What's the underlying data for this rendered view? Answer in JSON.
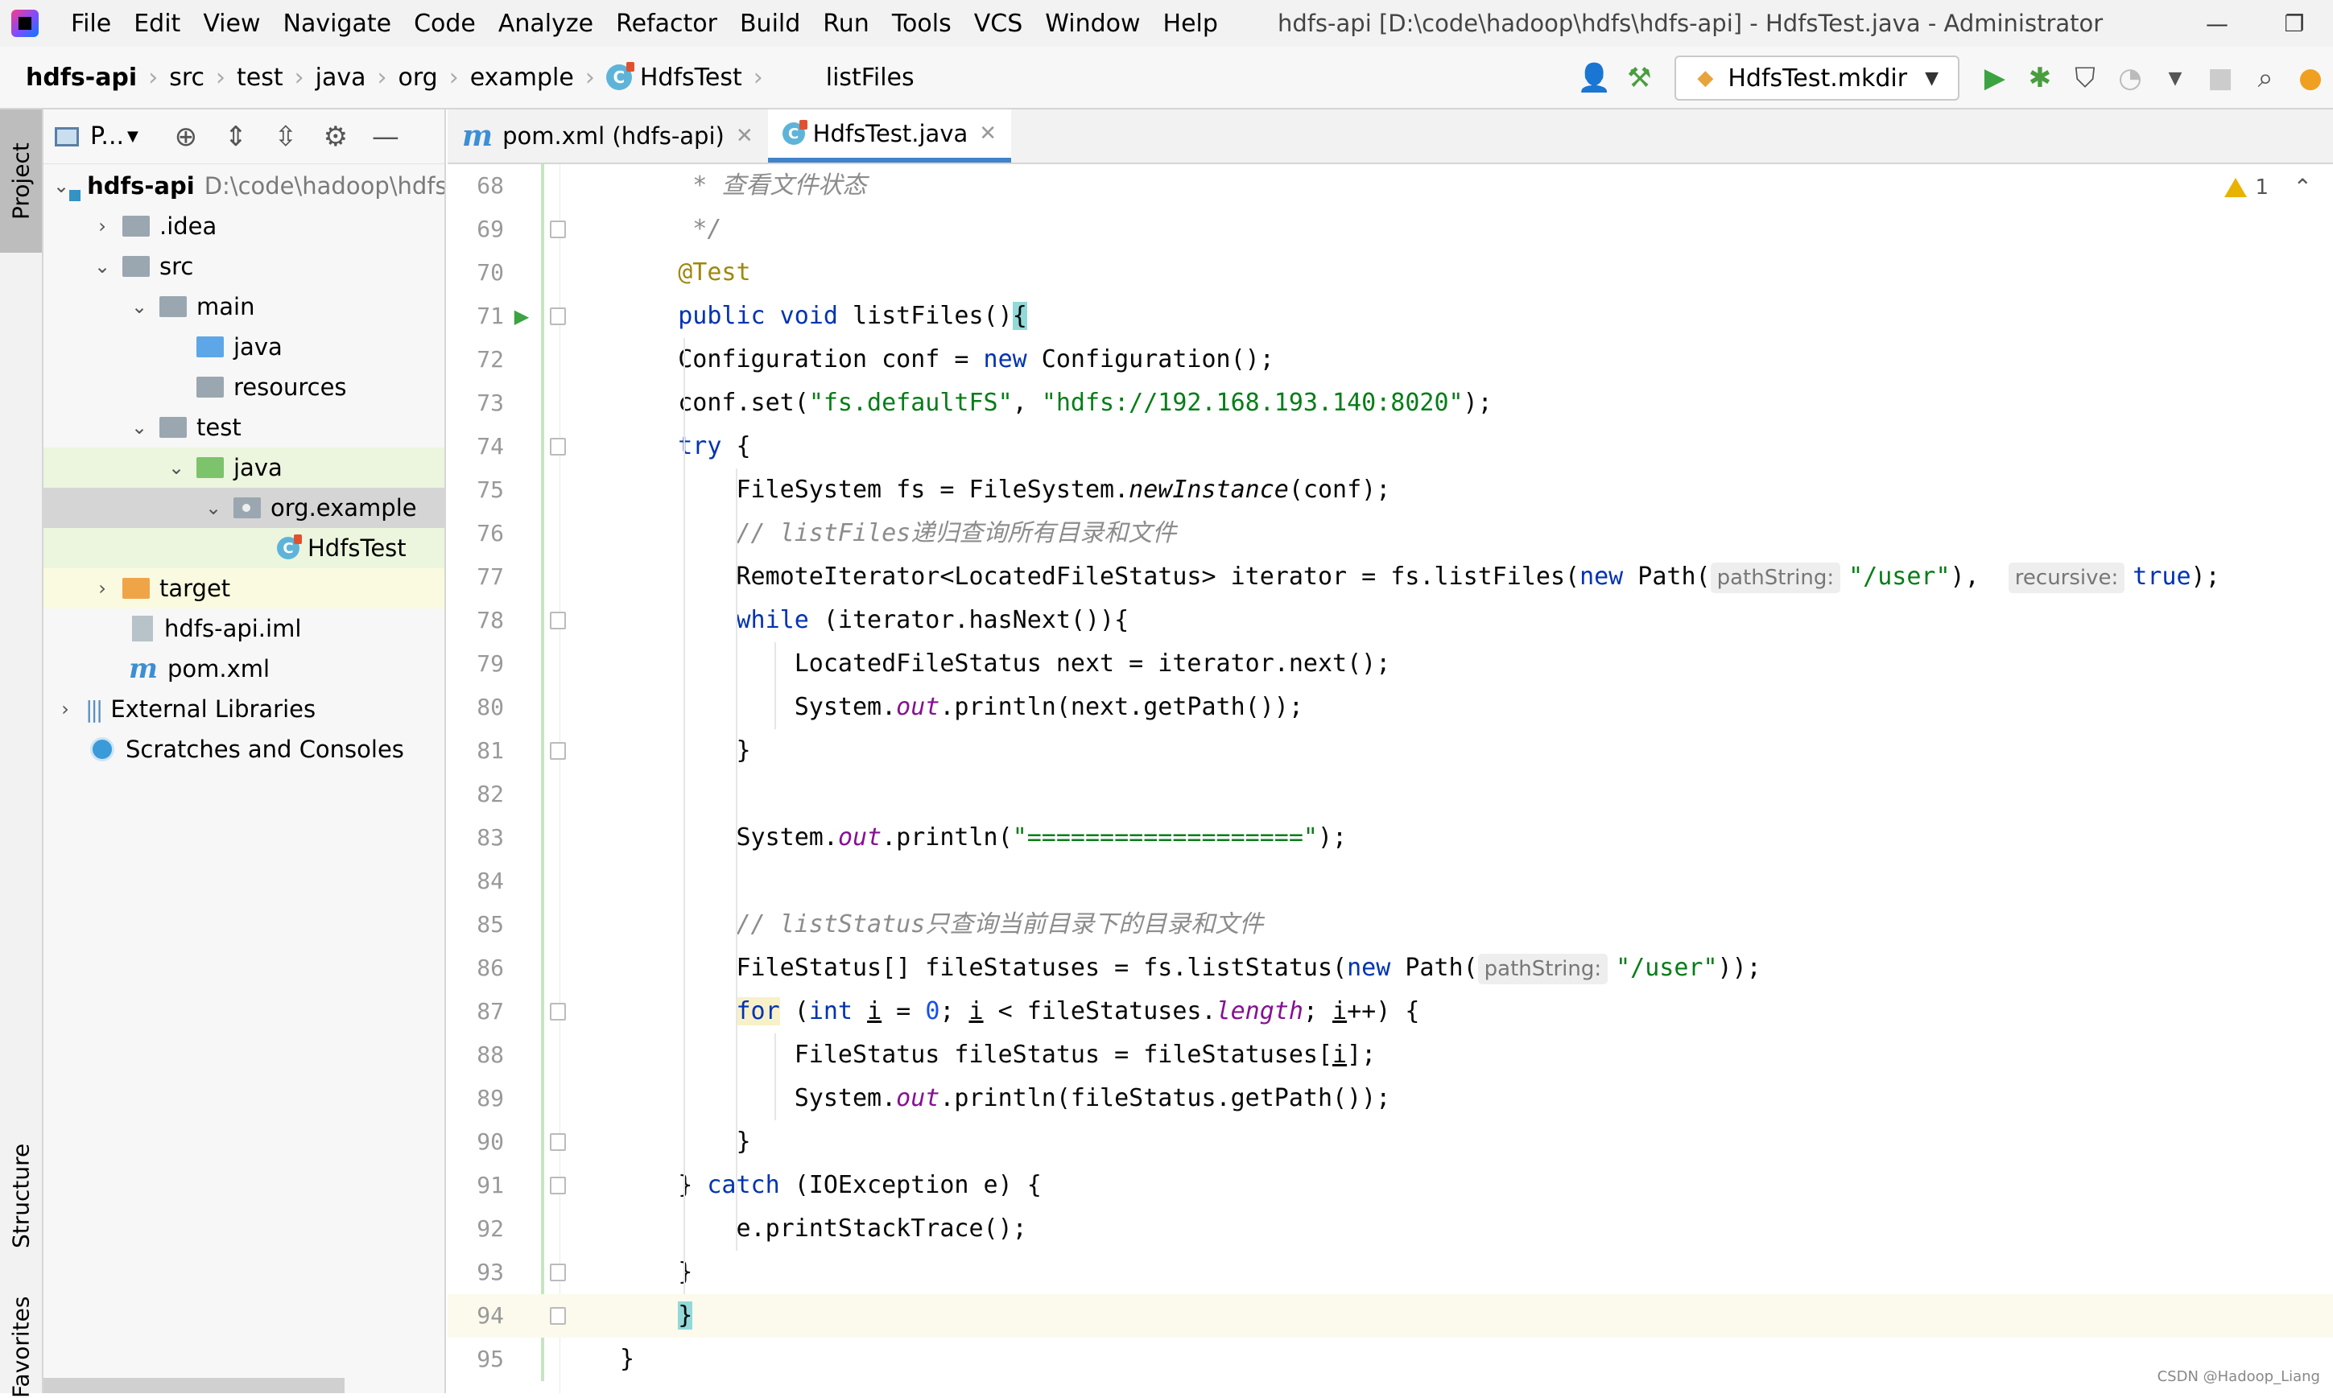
{
  "menubar": {
    "items": [
      "File",
      "Edit",
      "View",
      "Navigate",
      "Code",
      "Analyze",
      "Refactor",
      "Build",
      "Run",
      "Tools",
      "VCS",
      "Window",
      "Help"
    ],
    "window_title": "hdfs-api [D:\\code\\hadoop\\hdfs\\hdfs-api] - HdfsTest.java - Administrator"
  },
  "navbar": {
    "breadcrumbs": [
      "hdfs-api",
      "src",
      "test",
      "java",
      "org",
      "example",
      "HdfsTest"
    ],
    "method": "listFiles",
    "run_config": "HdfsTest.mkdir"
  },
  "sidebar_tabs": {
    "project": "Project",
    "structure": "Structure",
    "favorites": "Favorites"
  },
  "project_panel": {
    "title": "P...",
    "tree": [
      {
        "label": "hdfs-api",
        "path": "D:\\code\\hadoop\\hdfs\\hdfs-api"
      },
      {
        "label": ".idea"
      },
      {
        "label": "src"
      },
      {
        "label": "main"
      },
      {
        "label": "java"
      },
      {
        "label": "resources"
      },
      {
        "label": "test"
      },
      {
        "label": "java"
      },
      {
        "label": "org.example"
      },
      {
        "label": "HdfsTest"
      },
      {
        "label": "target"
      },
      {
        "label": "hdfs-api.iml"
      },
      {
        "label": "pom.xml"
      },
      {
        "label": "External Libraries"
      },
      {
        "label": "Scratches and Consoles"
      }
    ]
  },
  "editor": {
    "tabs": [
      {
        "label": "pom.xml (hdfs-api)",
        "active": false
      },
      {
        "label": "HdfsTest.java",
        "active": true
      }
    ],
    "warnings_count": "1",
    "line_numbers": [
      "68",
      "69",
      "70",
      "71",
      "72",
      "73",
      "74",
      "75",
      "76",
      "77",
      "78",
      "79",
      "80",
      "81",
      "82",
      "83",
      "84",
      "85",
      "86",
      "87",
      "88",
      "89",
      "90",
      "91",
      "92",
      "93",
      "94",
      "95"
    ],
    "code": {
      "l68": "     * 查看文件状态",
      "l69": "     */",
      "l70": "@Test",
      "l71_kw": "public void ",
      "l71_name": "listFiles()",
      "l71_brace": "{",
      "l72_a": "    Configuration conf = ",
      "l72_kw": "new",
      "l72_b": " Configuration();",
      "l73_a": "    conf.set(",
      "l73_s1": "\"fs.defaultFS\"",
      "l73_b": ", ",
      "l73_s2": "\"hdfs://192.168.193.140:8020\"",
      "l73_c": ");",
      "l74_kw": "try",
      "l74_b": " {",
      "l75_a": "        FileSystem fs = FileSystem.",
      "l75_it": "newInstance",
      "l75_b": "(conf);",
      "l76": "        // listFiles递归查询所有目录和文件",
      "l77_a": "        RemoteIterator<LocatedFileStatus> iterator = fs.listFiles(",
      "l77_kw": "new",
      "l77_b": " Path(",
      "l77_hint1": "pathString:",
      "l77_s": "\"/user\"",
      "l77_c": "),  ",
      "l77_hint2": "recursive:",
      "l77_kw2": "true",
      "l77_d": ");",
      "l78_kw": "while",
      "l78_b": " (iterator.hasNext()){",
      "l79": "            LocatedFileStatus next = iterator.next();",
      "l80_a": "            System.",
      "l80_f": "out",
      "l80_b": ".println(next.getPath());",
      "l81": "        }",
      "l83_a": "        System.",
      "l83_f": "out",
      "l83_b": ".println(",
      "l83_s": "\"===================\"",
      "l83_c": ");",
      "l85": "        // listStatus只查询当前目录下的目录和文件",
      "l86_a": "        FileStatus[] fileStatuses = fs.listStatus(",
      "l86_kw": "new",
      "l86_b": " Path(",
      "l86_hint": "pathString:",
      "l86_s": "\"/user\"",
      "l86_c": "));",
      "l87_kw": "for",
      "l87_a": " (",
      "l87_kw2": "int",
      "l87_b": " ",
      "l87_i1": "i",
      "l87_c": " = ",
      "l87_n": "0",
      "l87_d": "; ",
      "l87_i2": "i",
      "l87_e": " < fileStatuses.",
      "l87_f": "length",
      "l87_g": "; ",
      "l87_i3": "i",
      "l87_h": "++) {",
      "l88_a": "            FileStatus fileStatus = fileStatuses[",
      "l88_i": "i",
      "l88_b": "];",
      "l89_a": "            System.",
      "l89_f": "out",
      "l89_b": ".println(fileStatus.getPath());",
      "l90": "        }",
      "l91_a": "    } ",
      "l91_kw": "catch",
      "l91_b": " (IOException e) {",
      "l92": "        e.printStackTrace();",
      "l93": "    }",
      "l94": "}",
      "l95": "}"
    }
  },
  "watermark": "CSDN @Hadoop_Liang"
}
